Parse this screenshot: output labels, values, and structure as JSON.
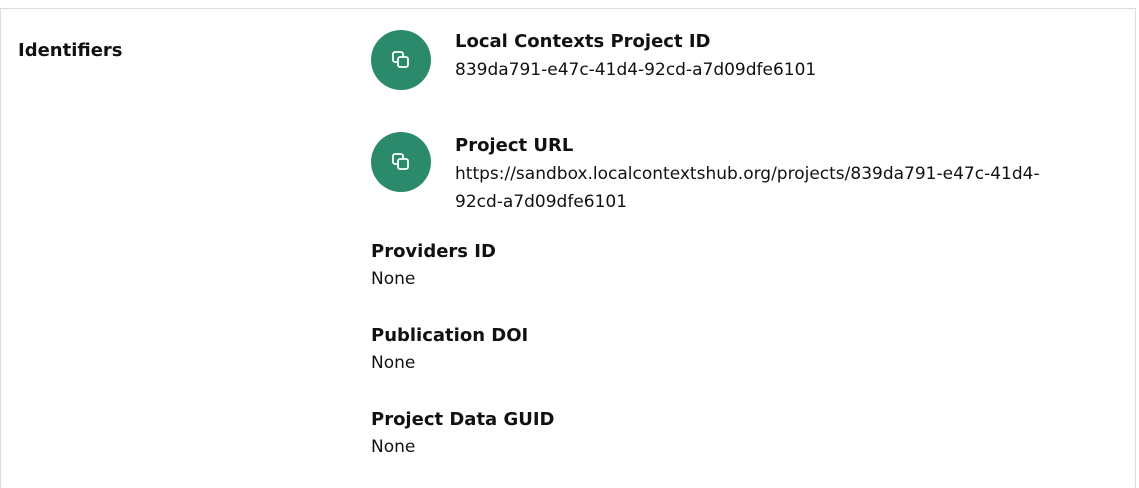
{
  "section": {
    "title": "Identifiers"
  },
  "identifiers": {
    "local_contexts_project_id": {
      "label": "Local Contexts Project ID",
      "value": "839da791-e47c-41d4-92cd-a7d09dfe6101",
      "icon": "copy-icon"
    },
    "project_url": {
      "label": "Project URL",
      "value_line1": "https://sandbox.localcontextshub.org/projects/839da791-e47c-41d4-",
      "value_line2": "92cd-a7d09dfe6101",
      "icon": "copy-icon"
    },
    "providers_id": {
      "label": "Providers ID",
      "value": "None"
    },
    "publication_doi": {
      "label": "Publication DOI",
      "value": "None"
    },
    "project_data_guid": {
      "label": "Project Data GUID",
      "value": "None"
    }
  },
  "colors": {
    "accent": "#2b8a6b",
    "border": "#dddddd",
    "text": "#111111"
  }
}
